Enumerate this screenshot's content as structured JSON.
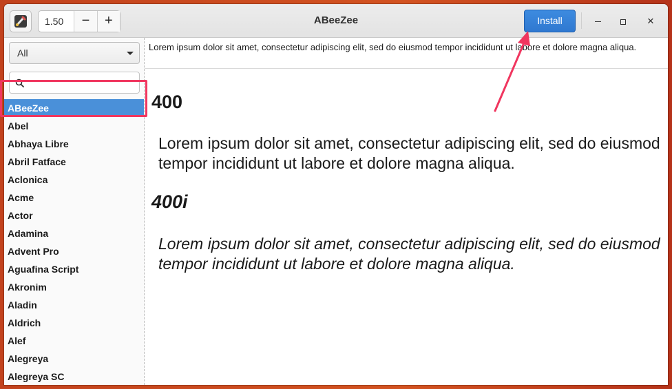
{
  "window": {
    "title": "ABeeZee"
  },
  "toolbar": {
    "app_icon": "brush-wrench-icon",
    "size_value": "1.50",
    "minus_label": "−",
    "plus_label": "+",
    "install_label": "Install",
    "install_color": "#3584e4"
  },
  "sidebar": {
    "filter_value": "All",
    "search_placeholder": "",
    "selected": "ABeeZee",
    "fonts": [
      "ABeeZee",
      "Abel",
      "Abhaya Libre",
      "Abril Fatface",
      "Aclonica",
      "Acme",
      "Actor",
      "Adamina",
      "Advent Pro",
      "Aguafina Script",
      "Akronim",
      "Aladin",
      "Aldrich",
      "Alef",
      "Alegreya",
      "Alegreya SC"
    ]
  },
  "preview": {
    "sample_text": "Lorem ipsum dolor sit amet, consectetur adipiscing elit, sed do eiusmod tempor incididunt ut labore et dolore magna aliqua.",
    "weights": [
      {
        "label": "400",
        "sample": "Lorem ipsum dolor sit amet, consectetur adipiscing elit, sed do eiusmod tempor incididunt ut labore et dolore magna aliqua."
      },
      {
        "label": "400i",
        "sample": "Lorem ipsum dolor sit amet, consectetur adipiscing elit, sed do eiusmod tempor incididunt ut labore et dolore magna aliqua."
      }
    ]
  },
  "annotation": {
    "color": "#f0365f"
  }
}
